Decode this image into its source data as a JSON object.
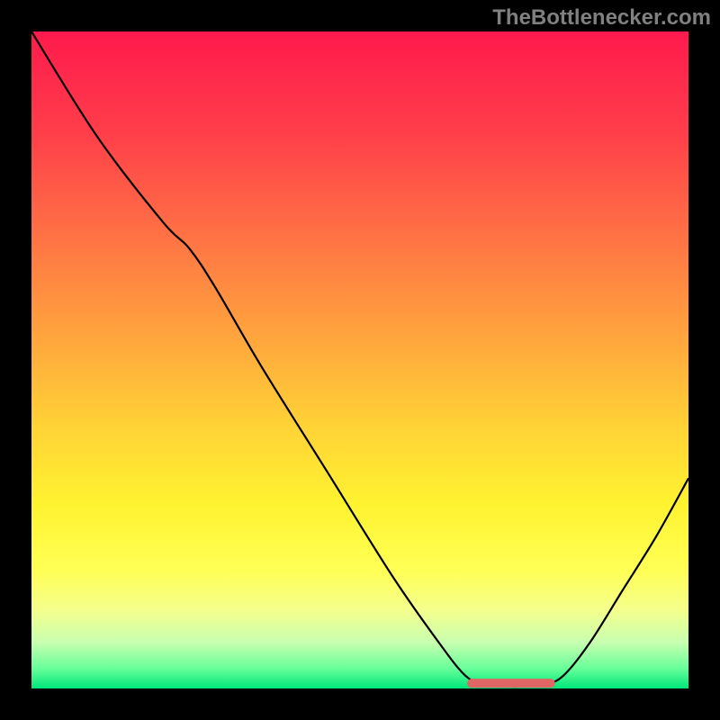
{
  "watermark": "TheBottlenecker.com",
  "chart_data": {
    "type": "line",
    "title": "",
    "xlabel": "",
    "ylabel": "",
    "xlim": [
      0,
      100
    ],
    "ylim": [
      0,
      100
    ],
    "background_gradient": {
      "stops": [
        {
          "offset": 0,
          "color": "#ff1a4d"
        },
        {
          "offset": 15,
          "color": "#ff3d4a"
        },
        {
          "offset": 30,
          "color": "#ff6e45"
        },
        {
          "offset": 45,
          "color": "#ffa03e"
        },
        {
          "offset": 60,
          "color": "#ffd236"
        },
        {
          "offset": 72,
          "color": "#fff330"
        },
        {
          "offset": 82,
          "color": "#ffff55"
        },
        {
          "offset": 88,
          "color": "#f5ff8c"
        },
        {
          "offset": 93,
          "color": "#c8ffb0"
        },
        {
          "offset": 97,
          "color": "#66ff99"
        },
        {
          "offset": 100,
          "color": "#00e67a"
        }
      ]
    },
    "series": [
      {
        "name": "bottleneck-curve",
        "color": "#000000",
        "width": 2.2,
        "points": [
          {
            "x": 0,
            "y": 100
          },
          {
            "x": 10,
            "y": 84
          },
          {
            "x": 20,
            "y": 71
          },
          {
            "x": 24,
            "y": 67
          },
          {
            "x": 28,
            "y": 61
          },
          {
            "x": 35,
            "y": 49
          },
          {
            "x": 45,
            "y": 33
          },
          {
            "x": 55,
            "y": 17
          },
          {
            "x": 62,
            "y": 7
          },
          {
            "x": 66,
            "y": 2
          },
          {
            "x": 69,
            "y": 0.5
          },
          {
            "x": 72,
            "y": 0.3
          },
          {
            "x": 75,
            "y": 0.3
          },
          {
            "x": 78,
            "y": 0.5
          },
          {
            "x": 81,
            "y": 2
          },
          {
            "x": 85,
            "y": 7
          },
          {
            "x": 90,
            "y": 15
          },
          {
            "x": 95,
            "y": 23
          },
          {
            "x": 100,
            "y": 32
          }
        ]
      }
    ],
    "marker": {
      "name": "optimal-range",
      "color": "#e06666",
      "x_start": 67,
      "x_end": 79,
      "y": 0.8,
      "thickness": 3.5
    }
  }
}
